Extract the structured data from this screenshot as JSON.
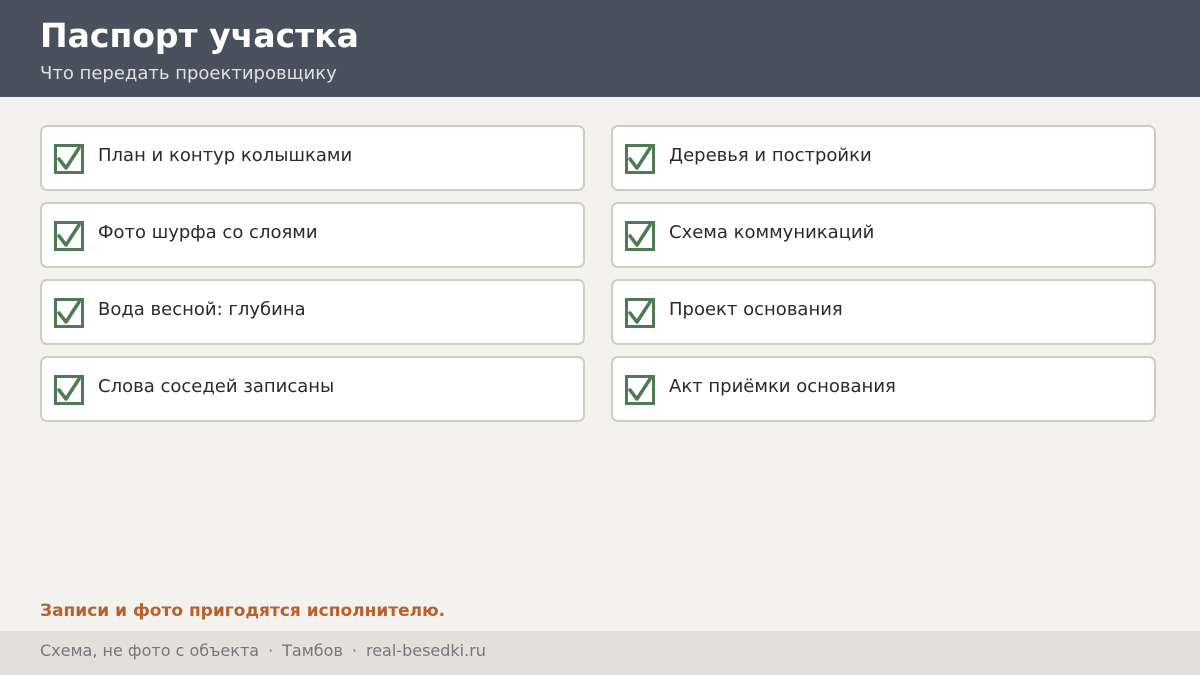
{
  "header": {
    "title": "Паспорт участка",
    "subtitle": "Что передать проектировщику"
  },
  "checklist": {
    "left": [
      {
        "label": "План и контур колышками",
        "checked": true,
        "icon": "checkbox-checked-icon"
      },
      {
        "label": "Фото шурфа со слоями",
        "checked": true,
        "icon": "checkbox-checked-icon"
      },
      {
        "label": "Вода весной: глубина",
        "checked": true,
        "icon": "checkbox-checked-icon"
      },
      {
        "label": "Слова соседей записаны",
        "checked": true,
        "icon": "checkbox-checked-icon"
      }
    ],
    "right": [
      {
        "label": "Деревья и постройки",
        "checked": true,
        "icon": "checkbox-checked-icon"
      },
      {
        "label": "Схема коммуникаций",
        "checked": true,
        "icon": "checkbox-checked-icon"
      },
      {
        "label": "Проект основания",
        "checked": true,
        "icon": "checkbox-checked-icon"
      },
      {
        "label": "Акт приёмки основания",
        "checked": true,
        "icon": "checkbox-checked-icon"
      }
    ]
  },
  "note": "Записи и фото пригодятся исполнителю.",
  "footer": {
    "caption": "Схема, не фото с объекта",
    "city": "Тамбов",
    "site": "real-besedki.ru",
    "separator": "·"
  },
  "colors": {
    "header_bg": "#48515d",
    "check_green": "#4e7a55",
    "note_accent": "#b8602e",
    "page_bg": "#f3f2ee"
  }
}
